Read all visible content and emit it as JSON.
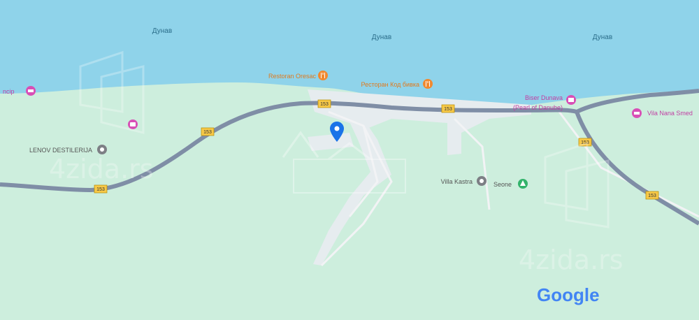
{
  "map": {
    "colors": {
      "water": "#8fd3ea",
      "land": "#cdeedd",
      "road_major": "#7f8ea6",
      "road_minor": "#f2f3f5",
      "poi_food": "#f1892f",
      "poi_lodging": "#d84fb6",
      "poi_generic": "#7d7f85",
      "poi_park": "#33b36b",
      "pin": "#1a73e8"
    },
    "water_labels": [
      "Дунав",
      "Дунав",
      "Дунав"
    ],
    "route_shields": [
      "153",
      "153",
      "153",
      "153",
      "153"
    ],
    "pois": [
      {
        "label": "Restoran Oresac",
        "type": "food",
        "icon": "fork-knife-icon"
      },
      {
        "label": "Ресторан Код бивка",
        "type": "food",
        "icon": "fork-knife-icon"
      },
      {
        "label": "Biser Dunava (Pearl of Danube)",
        "line1": "Biser Dunava",
        "line2": "(Pearl of Danube)",
        "type": "lodging",
        "icon": "hotel-icon"
      },
      {
        "label": "Vila Nana Smed",
        "type": "lodging",
        "icon": "bed-icon"
      },
      {
        "label": "ncip",
        "type": "lodging",
        "icon": "bed-icon"
      },
      {
        "label": "",
        "type": "lodging",
        "icon": "camera-icon"
      },
      {
        "label": "LENOV DESTILERIJA",
        "type": "generic",
        "icon": "dot-icon"
      },
      {
        "label": "Villa Kastra",
        "type": "generic",
        "icon": "dot-icon"
      },
      {
        "label": "Seone",
        "type": "park",
        "icon": "park-icon"
      }
    ],
    "attribution": "Google",
    "watermarks": [
      "4zida.rs",
      "4zida.rs"
    ]
  }
}
